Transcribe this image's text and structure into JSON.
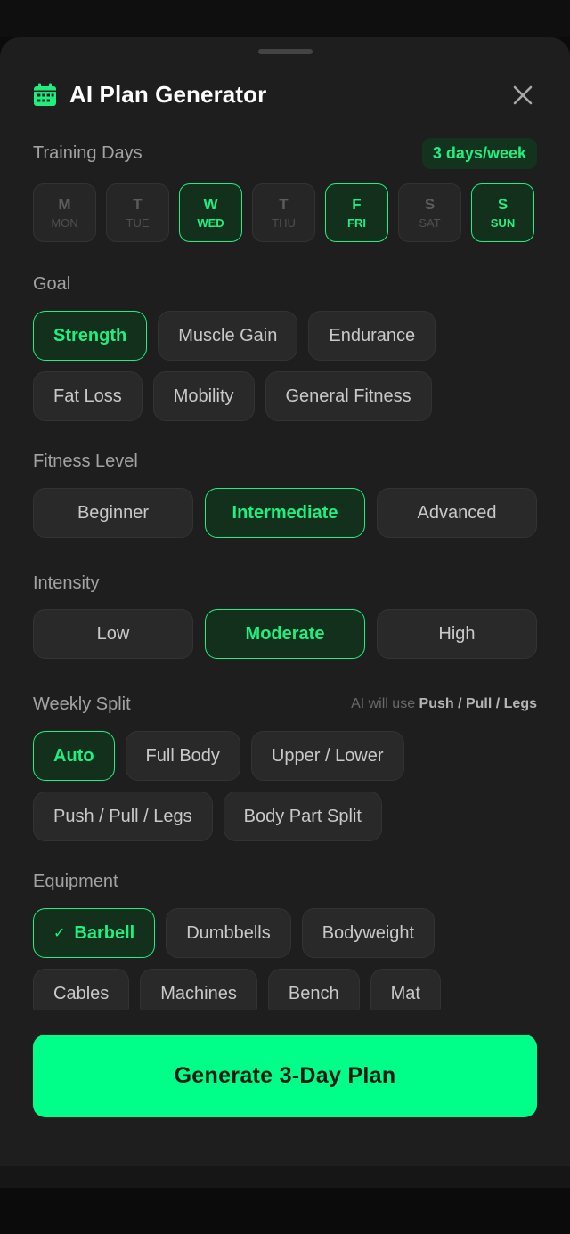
{
  "header": {
    "title": "AI Plan Generator",
    "icon": "calendar-icon",
    "close_icon": "close-icon"
  },
  "colors": {
    "accent": "#1ef07f",
    "cta": "#00ff88",
    "sheet": "#1e1e1e"
  },
  "training_days": {
    "label": "Training Days",
    "badge": "3 days/week",
    "days": [
      {
        "letter": "M",
        "abbr": "MON",
        "selected": false
      },
      {
        "letter": "T",
        "abbr": "TUE",
        "selected": false
      },
      {
        "letter": "W",
        "abbr": "WED",
        "selected": true
      },
      {
        "letter": "T",
        "abbr": "THU",
        "selected": false
      },
      {
        "letter": "F",
        "abbr": "FRI",
        "selected": true
      },
      {
        "letter": "S",
        "abbr": "SAT",
        "selected": false
      },
      {
        "letter": "S",
        "abbr": "SUN",
        "selected": true
      }
    ]
  },
  "goal": {
    "label": "Goal",
    "options": [
      "Strength",
      "Muscle Gain",
      "Endurance",
      "Fat Loss",
      "Mobility",
      "General Fitness"
    ],
    "selected": "Strength"
  },
  "fitness_level": {
    "label": "Fitness Level",
    "options": [
      "Beginner",
      "Intermediate",
      "Advanced"
    ],
    "selected": "Intermediate"
  },
  "intensity": {
    "label": "Intensity",
    "options": [
      "Low",
      "Moderate",
      "High"
    ],
    "selected": "Moderate"
  },
  "weekly_split": {
    "label": "Weekly Split",
    "hint_prefix": "AI will use",
    "hint_value": "Push / Pull / Legs",
    "options": [
      "Auto",
      "Full Body",
      "Upper / Lower",
      "Push / Pull / Legs",
      "Body Part Split"
    ],
    "selected": "Auto"
  },
  "equipment": {
    "label": "Equipment",
    "check_icon": "check-icon",
    "options": [
      "Barbell",
      "Dumbbells",
      "Bodyweight",
      "Cables",
      "Machines",
      "Bench",
      "Mat"
    ],
    "selected": [
      "Barbell"
    ]
  },
  "cta": {
    "label": "Generate 3-Day Plan"
  }
}
